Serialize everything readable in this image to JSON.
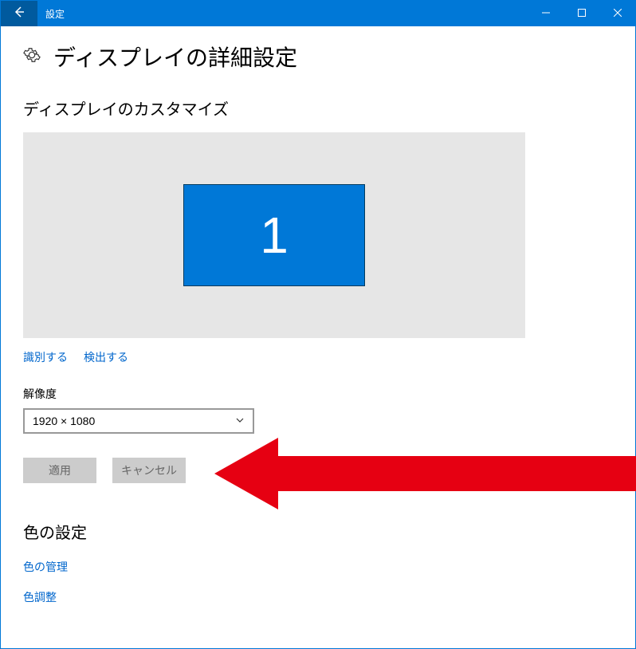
{
  "titlebar": {
    "title": "設定"
  },
  "page": {
    "title": "ディスプレイの詳細設定"
  },
  "customize": {
    "heading": "ディスプレイのカスタマイズ",
    "display_number": "1",
    "identify_link": "識別する",
    "detect_link": "検出する"
  },
  "resolution": {
    "label": "解像度",
    "value": "1920 × 1080"
  },
  "buttons": {
    "apply": "適用",
    "cancel": "キャンセル"
  },
  "color": {
    "heading": "色の設定",
    "manage_link": "色の管理",
    "adjust_link": "色調整"
  }
}
